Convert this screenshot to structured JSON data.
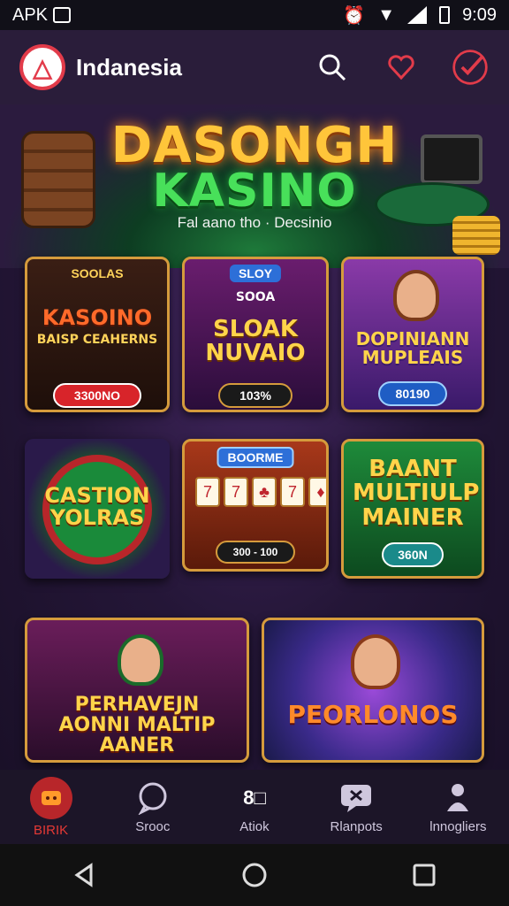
{
  "status_bar": {
    "carrier": "APK",
    "time": "9:09"
  },
  "header": {
    "title": "Indanesia"
  },
  "hero": {
    "title_line1": "DASONGH",
    "title_line2": "KASINO",
    "subtitle": "Fal aano tho · Decsinio"
  },
  "games": [
    {
      "tag": "SOOLAS",
      "title": "KASOINO",
      "subtitle": "BAISP CEAHERNS",
      "button": "3300NO"
    },
    {
      "tag": "SLOY",
      "badge": "SOOA",
      "title": "SLOAK NUVAIO",
      "button": "103%"
    },
    {
      "title": "DOPINIANN MUPLEAIS",
      "button": "80190"
    },
    {
      "title": "CASTION YOLRAS"
    },
    {
      "tag": "BOORME",
      "button": "300 - 100"
    },
    {
      "title": "BAANT MULTIULP MAINER",
      "button": "360N"
    },
    {
      "title": "PERHAVEJN AONNI MALTIP AANER"
    },
    {
      "title": "PEORLONOS"
    }
  ],
  "bottom_nav": [
    {
      "label": "BIRIK",
      "icon": "home-icon",
      "active": true
    },
    {
      "label": "Srooc",
      "icon": "chat-icon",
      "active": false
    },
    {
      "label": "Atiok",
      "icon": "number-icon",
      "active": false
    },
    {
      "label": "Rlanpots",
      "icon": "message-icon",
      "active": false
    },
    {
      "label": "lnnogliers",
      "icon": "profile-icon",
      "active": false
    }
  ],
  "colors": {
    "accent": "#e23b4a",
    "header_bg": "#2a1d3a",
    "card_border": "#d59b3c"
  }
}
